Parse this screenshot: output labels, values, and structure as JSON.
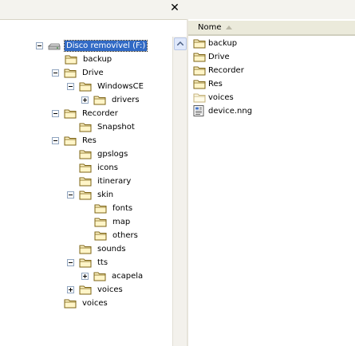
{
  "toolbar": {
    "close_glyph": "✕"
  },
  "tree": {
    "root_label": "Disco removível (F:)",
    "nodes": [
      {
        "label": "Disco removível (F:)",
        "toggle": "minus",
        "icon": "drive-icon",
        "selected": true
      },
      {
        "label": "backup",
        "toggle": "none",
        "icon": "folder-icon"
      },
      {
        "label": "Drive",
        "toggle": "minus",
        "icon": "folder-icon"
      },
      {
        "label": "WindowsCE",
        "toggle": "minus",
        "icon": "folder-icon"
      },
      {
        "label": "drivers",
        "toggle": "plus",
        "icon": "folder-icon"
      },
      {
        "label": "Recorder",
        "toggle": "minus",
        "icon": "folder-icon"
      },
      {
        "label": "Snapshot",
        "toggle": "none",
        "icon": "folder-icon"
      },
      {
        "label": "Res",
        "toggle": "minus",
        "icon": "folder-icon"
      },
      {
        "label": "gpslogs",
        "toggle": "none",
        "icon": "folder-icon"
      },
      {
        "label": "icons",
        "toggle": "none",
        "icon": "folder-icon"
      },
      {
        "label": "itinerary",
        "toggle": "none",
        "icon": "folder-icon"
      },
      {
        "label": "skin",
        "toggle": "minus",
        "icon": "folder-icon"
      },
      {
        "label": "fonts",
        "toggle": "none",
        "icon": "folder-icon"
      },
      {
        "label": "map",
        "toggle": "none",
        "icon": "folder-icon"
      },
      {
        "label": "others",
        "toggle": "none",
        "icon": "folder-icon"
      },
      {
        "label": "sounds",
        "toggle": "none",
        "icon": "folder-icon"
      },
      {
        "label": "tts",
        "toggle": "minus",
        "icon": "folder-icon"
      },
      {
        "label": "acapela",
        "toggle": "plus",
        "icon": "folder-icon"
      },
      {
        "label": "voices",
        "toggle": "plus",
        "icon": "folder-icon"
      },
      {
        "label": "voices",
        "toggle": "none",
        "icon": "folder-icon"
      }
    ]
  },
  "list": {
    "column_header": "Nome",
    "items": [
      {
        "label": "backup",
        "icon": "folder-icon"
      },
      {
        "label": "Drive",
        "icon": "folder-icon"
      },
      {
        "label": "Recorder",
        "icon": "folder-icon"
      },
      {
        "label": "Res",
        "icon": "folder-icon"
      },
      {
        "label": "voices",
        "icon": "folder-empty-icon"
      },
      {
        "label": "device.nng",
        "icon": "file-icon"
      }
    ]
  },
  "colors": {
    "selection": "#316ac5",
    "folder_fill": "#fff5c8",
    "folder_stroke": "#7e6414",
    "header_bg": "#ebeadb"
  }
}
